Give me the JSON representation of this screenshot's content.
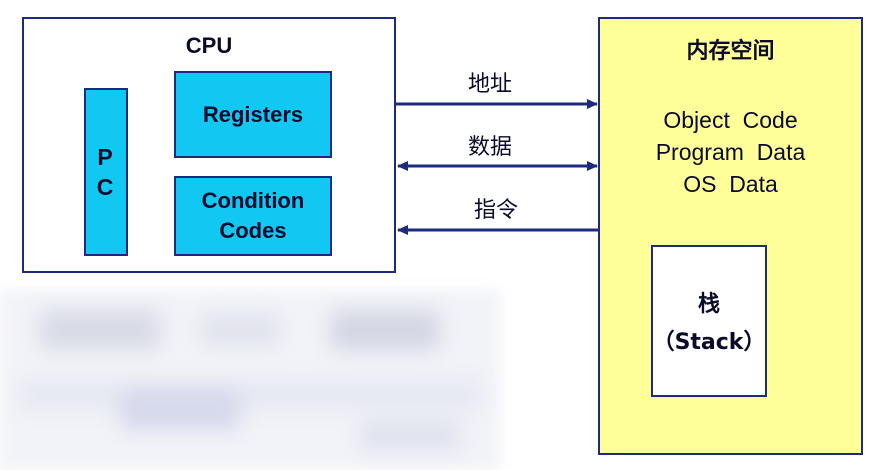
{
  "cpu": {
    "title": "CPU",
    "pc_label": "PC",
    "registers_label": "Registers",
    "condition_codes_line1": "Condition",
    "condition_codes_line2": "Codes"
  },
  "memory": {
    "title": "内存空间",
    "lines": [
      "Object  Code",
      "Program  Data",
      "OS  Data"
    ],
    "stack_line1": "栈",
    "stack_line2": "（Stack）"
  },
  "arrows": [
    {
      "label": "地址",
      "direction": "cpu-to-memory"
    },
    {
      "label": "数据",
      "direction": "bidirectional"
    },
    {
      "label": "指令",
      "direction": "memory-to-cpu"
    }
  ],
  "colors": {
    "border": "#1c2a80",
    "cpu_component_fill": "#11c8f2",
    "memory_fill": "#ffff99",
    "stack_fill": "#ffffff"
  }
}
